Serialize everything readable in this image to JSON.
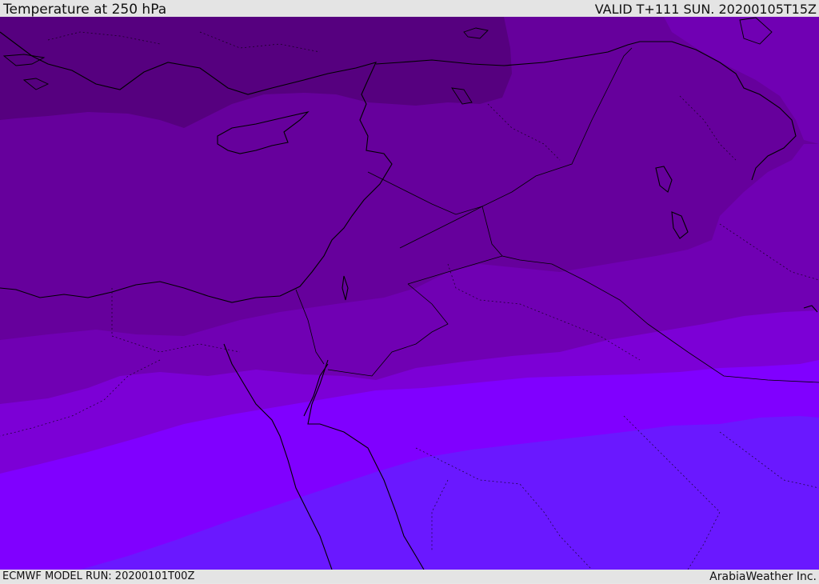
{
  "header": {
    "title": "Temperature at 250 hPa",
    "valid_time": "VALID T+111 SUN. 20200105T15Z"
  },
  "footer": {
    "model_run": "ECMWF MODEL RUN: 20200101T00Z",
    "credit": "ArabiaWeather Inc."
  },
  "colors": {
    "band_coldest": "#56007f",
    "band_cold": "#66009c",
    "band_cool": "#7000b3",
    "band_mild": "#7c00d6",
    "band_warm": "#8000ff",
    "band_warmest": "#6a18ff",
    "coastline": "#000000",
    "background": "#e4e4e4"
  }
}
